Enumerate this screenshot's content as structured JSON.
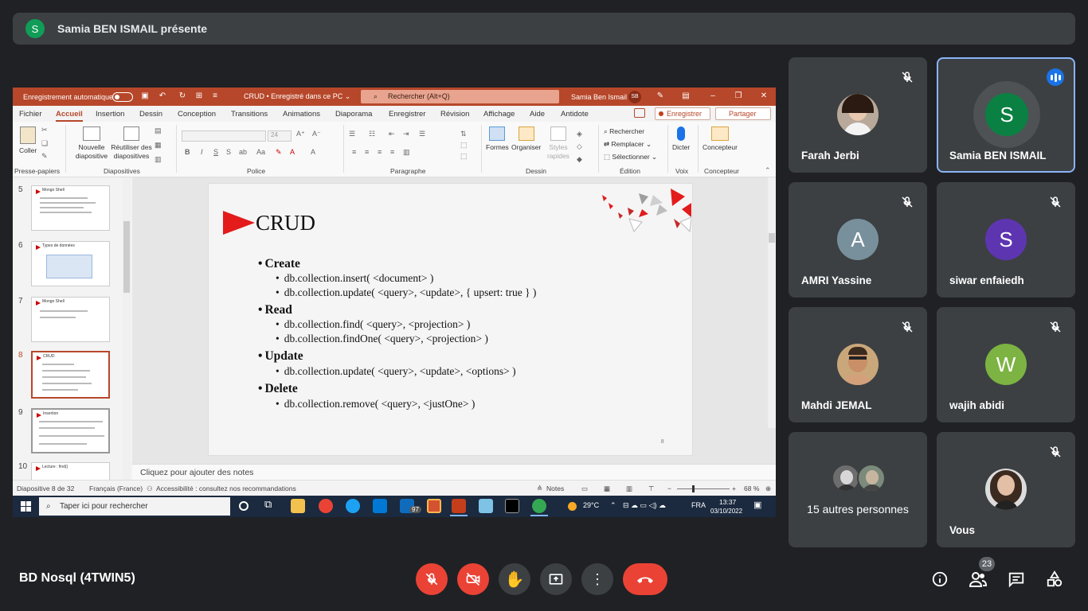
{
  "presenter": {
    "initial": "S",
    "label": "Samia BEN ISMAIL présente"
  },
  "ppt": {
    "autosave": "Enregistrement automatique",
    "doc_title": "CRUD • Enregistré dans ce PC ⌄",
    "search_placeholder": "Rechercher (Alt+Q)",
    "user_name": "Samia Ben Ismail",
    "user_initials": "SB",
    "tabs": [
      "Fichier",
      "Accueil",
      "Insertion",
      "Dessin",
      "Conception",
      "Transitions",
      "Animations",
      "Diaporama",
      "Enregistrer",
      "Révision",
      "Affichage",
      "Aide",
      "Antidote"
    ],
    "record_label": "Enregistrer",
    "share_label": "Partager",
    "ribbon": {
      "paste": "Coller",
      "new_slide": "Nouvelle diapositive",
      "reuse_slides": "Réutiliser des diapositives",
      "font_size": "24",
      "find": "Rechercher",
      "replace": "Remplacer",
      "select": "Sélectionner",
      "dictate": "Dicter",
      "designer": "Concepteur",
      "shapes": "Formes",
      "arrange": "Organiser",
      "quick_styles": "Styles rapides",
      "groups": [
        "Presse-papiers",
        "Diapositives",
        "Police",
        "Paragraphe",
        "Dessin",
        "Édition",
        "Voix",
        "Concepteur"
      ]
    },
    "thumbnails": [
      {
        "num": "5",
        "title": "Mongo Shell"
      },
      {
        "num": "6",
        "title": "Types de données"
      },
      {
        "num": "7",
        "title": "Mongo Shell"
      },
      {
        "num": "8",
        "title": "CRUD"
      },
      {
        "num": "9",
        "title": "Insertion"
      },
      {
        "num": "10",
        "title": "Lecture : find()"
      }
    ],
    "slide": {
      "title": "CRUD",
      "create": "Create",
      "create_1": "db.collection.insert( <document> )",
      "create_2": "db.collection.update( <query>, <update>, { upsert: true } )",
      "read": "Read",
      "read_1": "db.collection.find( <query>, <projection> )",
      "read_2": "db.collection.findOne( <query>, <projection> )",
      "update": "Update",
      "update_1": "db.collection.update( <query>, <update>, <options> )",
      "delete": "Delete",
      "delete_1": "db.collection.remove( <query>, <justOne> )",
      "page": "8"
    },
    "notes_placeholder": "Cliquez pour ajouter des notes",
    "status": {
      "slide_of": "Diapositive 8 de 32",
      "language": "Français (France)",
      "accessibility": "Accessibilité : consultez nos recommandations",
      "notes": "Notes",
      "zoom": "68 %"
    }
  },
  "taskbar": {
    "search_placeholder": "Taper ici pour rechercher",
    "mail_badge": "97",
    "weather": "29°C",
    "lang": "FRA",
    "time": "13:37",
    "date": "03/10/2022"
  },
  "participants": [
    {
      "name": "Farah Jerbi",
      "muted": true
    },
    {
      "name": "Samia BEN ISMAIL",
      "initial": "S",
      "color": "#0b8043",
      "speaking": true
    },
    {
      "name": "AMRI Yassine",
      "initial": "A",
      "color": "#78909c",
      "muted": true
    },
    {
      "name": "siwar enfaiedh",
      "initial": "S",
      "color": "#5e35b1",
      "muted": true
    },
    {
      "name": "Mahdi JEMAL",
      "muted": true
    },
    {
      "name": "wajih abidi",
      "initial": "W",
      "color": "#7cb342",
      "muted": true
    },
    {
      "name": "15 autres personnes"
    },
    {
      "name": "Vous",
      "muted": true
    }
  ],
  "meeting": {
    "name": "BD Nosql (4TWIN5)",
    "participant_count": "23"
  }
}
